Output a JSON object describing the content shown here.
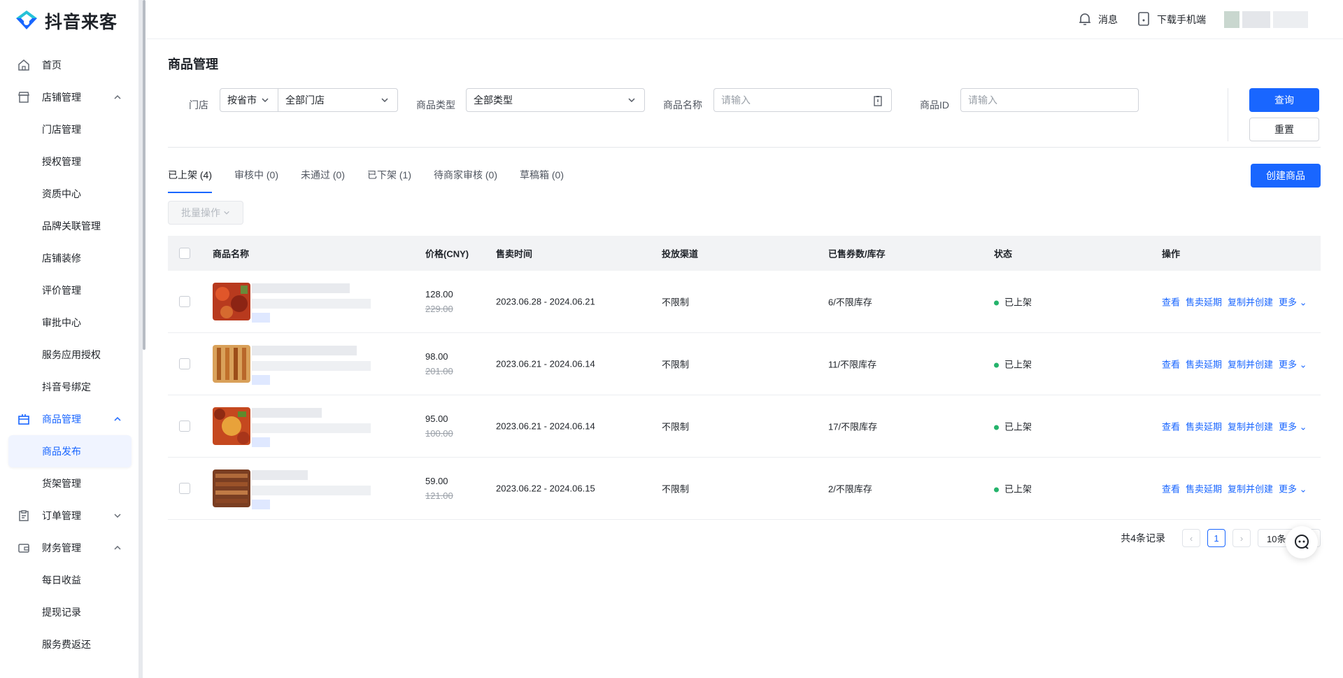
{
  "app": {
    "name": "抖音来客"
  },
  "sidebar": {
    "items": [
      {
        "label": "首页",
        "icon": "home-icon"
      },
      {
        "label": "店铺管理",
        "icon": "store-icon",
        "children": [
          "门店管理",
          "授权管理",
          "资质中心",
          "品牌关联管理",
          "店铺装修",
          "评价管理",
          "审批中心",
          "服务应用授权",
          "抖音号绑定"
        ]
      },
      {
        "label": "商品管理",
        "icon": "gift-box-icon",
        "children": [
          "商品发布",
          "货架管理"
        ]
      },
      {
        "label": "订单管理",
        "icon": "clipboard-icon"
      },
      {
        "label": "财务管理",
        "icon": "wallet-icon",
        "children": [
          "每日收益",
          "提现记录",
          "服务费返还"
        ]
      }
    ],
    "selected": "商品发布"
  },
  "topbar": {
    "messages_label": "消息",
    "download_label": "下载手机端"
  },
  "page": {
    "title": "商品管理"
  },
  "filters": {
    "store_label": "门店",
    "store_scope": "按省市",
    "store_value": "全部门店",
    "type_label": "商品类型",
    "type_value": "全部类型",
    "name_label": "商品名称",
    "name_placeholder": "请输入",
    "id_label": "商品ID",
    "id_placeholder": "请输入",
    "query_label": "查询",
    "reset_label": "重置"
  },
  "tabs": [
    "已上架 (4)",
    "审核中 (0)",
    "未通过 (0)",
    "已下架 (1)",
    "待商家审核 (0)",
    "草稿箱 (0)"
  ],
  "create_label": "创建商品",
  "batch_label": "批量操作",
  "table": {
    "headers": [
      "商品名称",
      "价格(CNY)",
      "售卖时间",
      "投放渠道",
      "已售券数/库存",
      "状态",
      "操作"
    ],
    "rows": [
      {
        "price": "128.00",
        "old_price": "229.00",
        "period": "2023.06.28 - 2024.06.21",
        "channel": "不限制",
        "sold": "6/不限库存",
        "status": "已上架"
      },
      {
        "price": "98.00",
        "old_price": "201.00",
        "period": "2023.06.21 - 2024.06.14",
        "channel": "不限制",
        "sold": "11/不限库存",
        "status": "已上架"
      },
      {
        "price": "95.00",
        "old_price": "100.00",
        "period": "2023.06.21 - 2024.06.14",
        "channel": "不限制",
        "sold": "17/不限库存",
        "status": "已上架"
      },
      {
        "price": "59.00",
        "old_price": "121.00",
        "period": "2023.06.22 - 2024.06.15",
        "channel": "不限制",
        "sold": "2/不限库存",
        "status": "已上架"
      }
    ],
    "actions": [
      "查看",
      "售卖延期",
      "复制并创建",
      "更多"
    ]
  },
  "pagination": {
    "total_text": "共4条记录",
    "current_page": "1",
    "page_size": "10条"
  },
  "colors": {
    "accent": "#1966ff",
    "status_green": "#24b36b"
  }
}
